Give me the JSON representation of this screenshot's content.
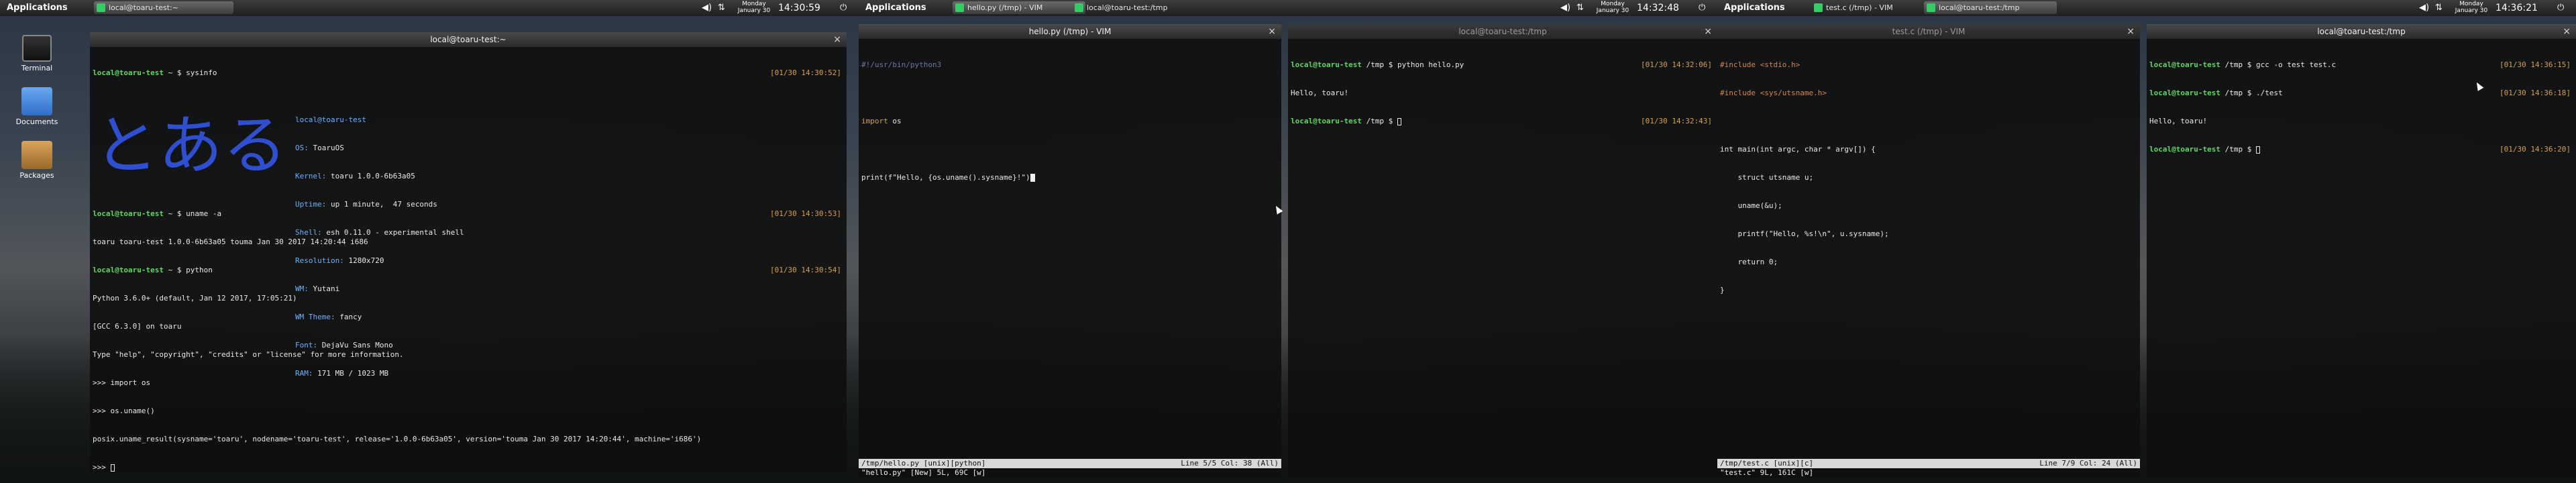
{
  "screens": [
    {
      "panel": {
        "apps_label": "Applications",
        "tasks": [
          "local@toaru-test:~"
        ],
        "date": "Monday January 30",
        "time": "14:30:59"
      },
      "desktop_icons": [
        "Terminal",
        "Documents",
        "Packages"
      ],
      "window": {
        "title": "local@toaru-test:~",
        "lines": [
          {
            "user": "local@toaru-test",
            "path": "~",
            "sym": "$",
            "cmd": "sysinfo",
            "ts": "[01/30 14:30:52]"
          },
          {
            "info": [
              [
                "",
                "local@toaru-test"
              ],
              [
                "OS: ",
                "ToaruOS"
              ],
              [
                "Kernel: ",
                "toaru 1.0.0-6b63a05"
              ],
              [
                "Uptime: ",
                "up 1 minute,  47 seconds"
              ],
              [
                "Shell: ",
                "esh 0.11.0 - experimental shell"
              ],
              [
                "Resolution: ",
                "1280x720"
              ],
              [
                "WM: ",
                "Yutani"
              ],
              [
                "WM Theme: ",
                "fancy"
              ],
              [
                "Font: ",
                "DejaVu Sans Mono"
              ],
              [
                "RAM: ",
                "171 MB / 1023 MB"
              ]
            ]
          },
          {
            "user": "local@toaru-test",
            "path": "~",
            "sym": "$",
            "cmd": "uname -a",
            "ts": "[01/30 14:30:53]"
          },
          {
            "text": "toaru toaru-test 1.0.0-6b63a05 touma Jan 30 2017 14:20:44 i686"
          },
          {
            "user": "local@toaru-test",
            "path": "~",
            "sym": "$",
            "cmd": "python",
            "ts": "[01/30 14:30:54]"
          },
          {
            "text": "Python 3.6.0+ (default, Jan 12 2017, 17:05:21)"
          },
          {
            "text": "[GCC 6.3.0] on toaru"
          },
          {
            "text": "Type \"help\", \"copyright\", \"credits\" or \"license\" for more information."
          },
          {
            "text": ">>> import os"
          },
          {
            "text": ">>> os.uname()"
          },
          {
            "text": "posix.uname_result(sysname='toaru', nodename='toaru-test', release='1.0.0-6b63a05', version='touma Jan 30 2017 14:20:44', machine='i686')"
          },
          {
            "text": ">>> "
          }
        ]
      }
    },
    {
      "panel": {
        "apps_label": "Applications",
        "tasks": [
          "hello.py (/tmp) - VIM",
          "local@toaru-test:/tmp"
        ],
        "date": "Monday January 30",
        "time": "14:32:48"
      },
      "vim": {
        "title": "hello.py (/tmp) - VIM",
        "lines": [
          {
            "cls": "cm",
            "text": "#!/usr/bin/python3"
          },
          {
            "cls": "",
            "text": ""
          },
          {
            "cls": "kw",
            "text": "import",
            "rest": " os"
          },
          {
            "cls": "",
            "text": ""
          },
          {
            "cls": "",
            "text": "print(f\"Hello, {os.uname().sysname}!\")"
          }
        ],
        "status": "/tmp/hello.py [unix][python]",
        "status_right": "Line 5/5 Col: 38 (All)",
        "cmdline": "\"hello.py\" [New] 5L, 69C [w]"
      },
      "term": {
        "title": "local@toaru-test:/tmp",
        "lines": [
          {
            "user": "local@toaru-test",
            "path": "/tmp",
            "sym": "$",
            "cmd": "python hello.py",
            "ts": "[01/30 14:32:06]"
          },
          {
            "text": "Hello, toaru!"
          },
          {
            "user": "local@toaru-test",
            "path": "/tmp",
            "sym": "$",
            "cmd": "",
            "ts": "[01/30 14:32:43]"
          }
        ]
      }
    },
    {
      "panel": {
        "apps_label": "Applications",
        "tasks": [
          "test.c (/tmp) - VIM",
          "local@toaru-test:/tmp"
        ],
        "date": "Monday January 30",
        "time": "14:36:21"
      },
      "vim": {
        "title": "test.c (/tmp) - VIM",
        "lines": [
          {
            "cls": "inc",
            "text": "#include <stdio.h>"
          },
          {
            "cls": "inc",
            "text": "#include <sys/utsname.h>"
          },
          {
            "cls": "",
            "text": ""
          },
          {
            "cls": "",
            "text": "int main(int argc, char * argv[]) {"
          },
          {
            "cls": "",
            "text": "    struct utsname u;"
          },
          {
            "cls": "",
            "text": "    uname(&u);"
          },
          {
            "cls": "",
            "text": "    printf(\"Hello, %s!\\n\", u.sysname);"
          },
          {
            "cls": "",
            "text": "    return 0;"
          },
          {
            "cls": "",
            "text": "}"
          }
        ],
        "status": "/tmp/test.c [unix][c]",
        "status_right": "Line 7/9 Col: 24 (All)",
        "cmdline": "\"test.c\" 9L, 161C [w]"
      },
      "term": {
        "title": "local@toaru-test:/tmp",
        "lines": [
          {
            "user": "local@toaru-test",
            "path": "/tmp",
            "sym": "$",
            "cmd": "gcc -o test test.c",
            "ts": "[01/30 14:36:15]"
          },
          {
            "user": "local@toaru-test",
            "path": "/tmp",
            "sym": "$",
            "cmd": "./test",
            "ts": "[01/30 14:36:18]"
          },
          {
            "text": "Hello, toaru!"
          },
          {
            "user": "local@toaru-test",
            "path": "/tmp",
            "sym": "$",
            "cmd": "",
            "ts": "[01/30 14:36:20]"
          }
        ]
      }
    }
  ],
  "logo_text": "とある",
  "colors": {
    "prompt_user": "#5fd75f",
    "timestamp": "#d7a04a",
    "sysinfo_key": "#6ab0ff"
  }
}
